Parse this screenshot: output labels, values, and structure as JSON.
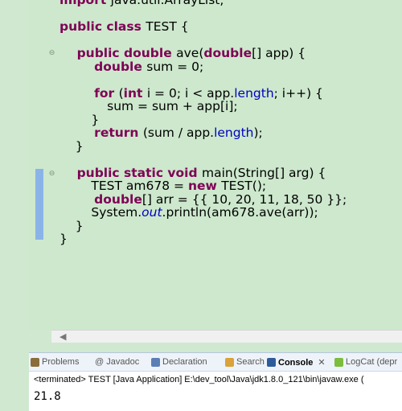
{
  "editor": {
    "lines": [
      [
        {
          "t": "import ",
          "c": "kw"
        },
        {
          "t": "java.util.ArrayList;",
          "c": ""
        }
      ],
      [],
      [
        {
          "t": "public class ",
          "c": "kw"
        },
        {
          "t": "TEST {",
          "c": ""
        }
      ],
      [],
      [
        {
          "t": "    public double ",
          "c": "kw"
        },
        {
          "t": "ave(",
          "c": ""
        },
        {
          "t": "double",
          "c": "kw"
        },
        {
          "t": "[] app) {",
          "c": ""
        }
      ],
      [
        {
          "t": "        double ",
          "c": "kw"
        },
        {
          "t": "sum = 0;",
          "c": ""
        }
      ],
      [],
      [
        {
          "t": "        for ",
          "c": "kw"
        },
        {
          "t": "(",
          "c": ""
        },
        {
          "t": "int ",
          "c": "kw"
        },
        {
          "t": "i = 0; i < app.",
          "c": ""
        },
        {
          "t": "length",
          "c": "fld"
        },
        {
          "t": "; i++) {",
          "c": ""
        }
      ],
      [
        {
          "t": "            sum = sum + app[i];",
          "c": ""
        }
      ],
      [
        {
          "t": "        }",
          "c": ""
        }
      ],
      [
        {
          "t": "        return ",
          "c": "kw"
        },
        {
          "t": "(sum / app.",
          "c": ""
        },
        {
          "t": "length",
          "c": "fld"
        },
        {
          "t": ");",
          "c": ""
        }
      ],
      [
        {
          "t": "    }",
          "c": ""
        }
      ],
      [],
      [
        {
          "t": "    public static void ",
          "c": "kw"
        },
        {
          "t": "main(String[] arg) {",
          "c": ""
        }
      ],
      [
        {
          "t": "        TEST am678 = ",
          "c": ""
        },
        {
          "t": "new ",
          "c": "kw"
        },
        {
          "t": "TEST();",
          "c": ""
        }
      ],
      [
        {
          "t": "        double",
          "c": "kw"
        },
        {
          "t": "[] arr = {{ 10, 20, 11, 18, 50 }};",
          "c": ""
        }
      ],
      [
        {
          "t": "        System.",
          "c": ""
        },
        {
          "t": "out",
          "c": "st"
        },
        {
          "t": ".println(am678.ave(arr));",
          "c": ""
        }
      ],
      [
        {
          "t": "    }",
          "c": ""
        }
      ],
      [
        {
          "t": "}",
          "c": ""
        }
      ]
    ]
  },
  "console": {
    "tabs": [
      {
        "label": "Problems",
        "icon": "problems-icon",
        "color": "#8a6d3b"
      },
      {
        "label": "@ Javadoc",
        "icon": "javadoc-icon",
        "color": ""
      },
      {
        "label": "Declaration",
        "icon": "declaration-icon",
        "color": "#5b7fb5"
      },
      {
        "label": "Search",
        "icon": "search-icon",
        "color": "#d9a23a"
      },
      {
        "label": "Console",
        "icon": "console-icon",
        "color": "#2e5c9a"
      },
      {
        "label": "LogCat (depr",
        "icon": "logcat-icon",
        "color": "#7bbd3c"
      }
    ],
    "status": "<terminated> TEST [Java Application] E:\\dev_tool\\Java\\jdk1.8.0_121\\bin\\javaw.exe (",
    "output": "21.8"
  }
}
